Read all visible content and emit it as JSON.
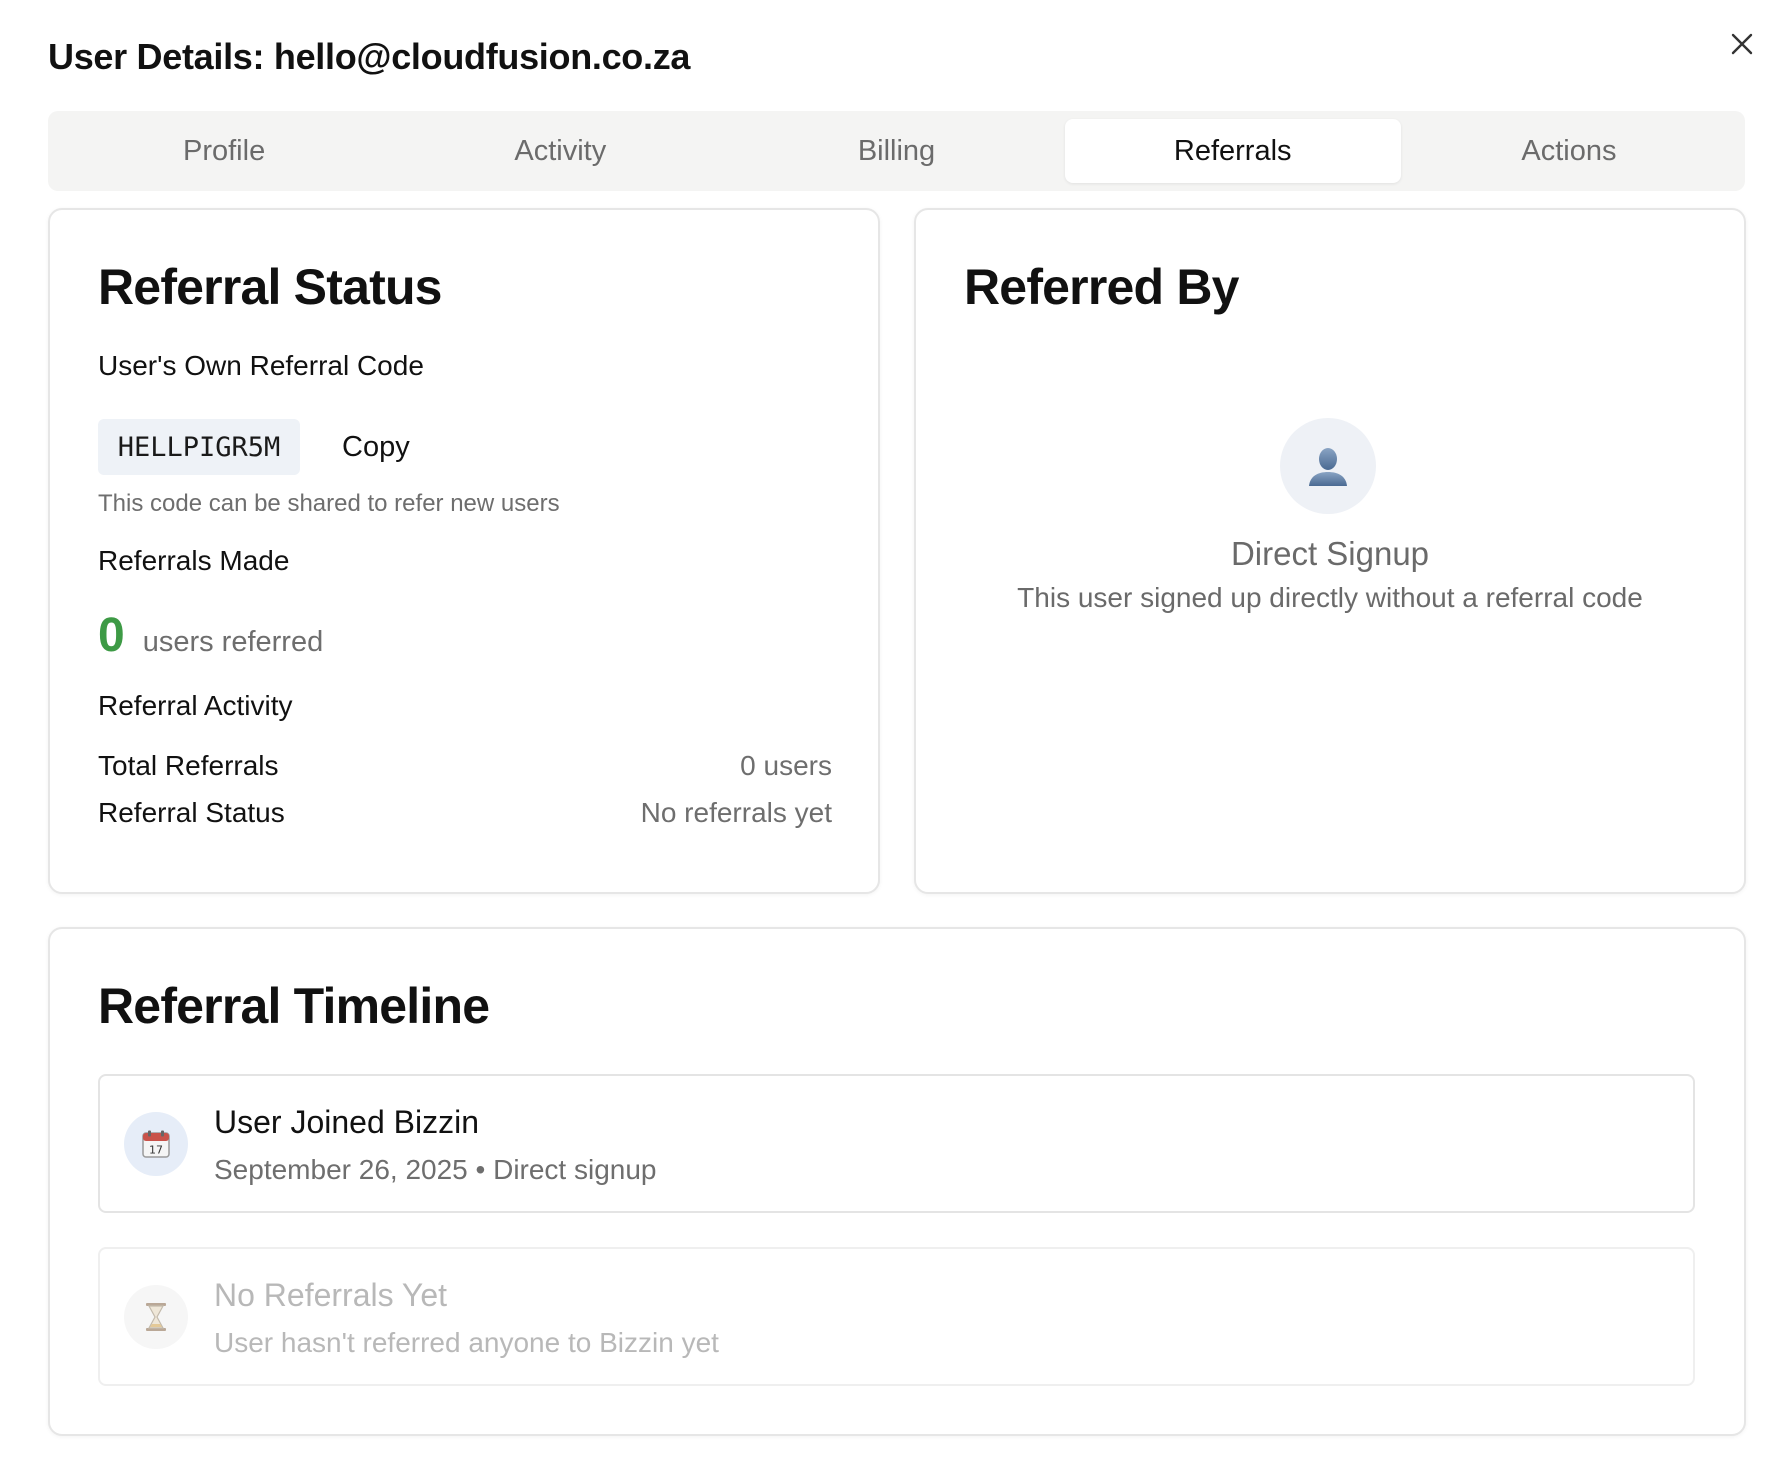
{
  "dialog": {
    "title": "User Details: hello@cloudfusion.co.za",
    "close_icon": "close-icon"
  },
  "tabs": [
    {
      "label": "Profile",
      "active": false
    },
    {
      "label": "Activity",
      "active": false
    },
    {
      "label": "Billing",
      "active": false
    },
    {
      "label": "Referrals",
      "active": true
    },
    {
      "label": "Actions",
      "active": false
    }
  ],
  "referral_status": {
    "title": "Referral Status",
    "own_code_label": "User's Own Referral Code",
    "code": "HELLPIGR5M",
    "copy_label": "Copy",
    "hint": "This code can be shared to refer new users",
    "referrals_made_label": "Referrals Made",
    "referrals_count": "0",
    "referrals_count_suffix": "users referred",
    "activity_label": "Referral Activity",
    "rows": [
      {
        "key": "Total Referrals",
        "value": "0 users"
      },
      {
        "key": "Referral Status",
        "value": "No referrals yet"
      }
    ]
  },
  "referred_by": {
    "title": "Referred By",
    "icon": "person-silhouette-icon",
    "status": "Direct Signup",
    "description": "This user signed up directly without a referral code"
  },
  "timeline": {
    "title": "Referral Timeline",
    "items": [
      {
        "icon": "calendar-icon",
        "title": "User Joined Bizzin",
        "subtitle": "September 26, 2025 • Direct signup",
        "muted": false
      },
      {
        "icon": "hourglass-icon",
        "title": "No Referrals Yet",
        "subtitle": "User hasn't referred anyone to Bizzin yet",
        "muted": true
      }
    ]
  },
  "colors": {
    "accent_green": "#3d9a45",
    "tab_bg": "#f4f4f3",
    "code_chip_bg": "#eef2f7"
  }
}
